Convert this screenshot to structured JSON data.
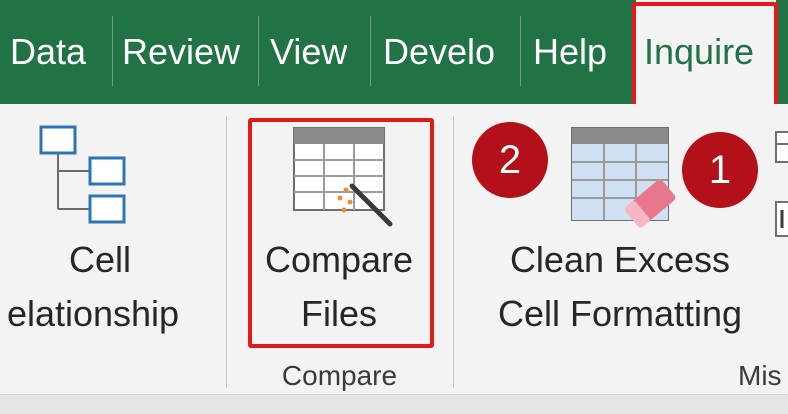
{
  "tabs": [
    {
      "label": "Data"
    },
    {
      "label": "Review"
    },
    {
      "label": "View"
    },
    {
      "label": "Develo"
    },
    {
      "label": "Help"
    },
    {
      "label": "Inquire"
    }
  ],
  "ribbon": {
    "cell_relationship": {
      "line1": "Cell",
      "line2": "elationship"
    },
    "compare_files": {
      "line1": "Compare",
      "line2": "Files"
    },
    "clean_excess": {
      "line1": "Clean Excess",
      "line2": "Cell Formatting"
    },
    "groups": {
      "compare": "Compare",
      "misc": "Mis"
    }
  },
  "badges": {
    "first": "1",
    "second": "2"
  },
  "colors": {
    "tab_bar": "#217346",
    "highlight": "#e11a1a",
    "badge": "#b3101a",
    "icon_blue": "#2e75b6"
  }
}
